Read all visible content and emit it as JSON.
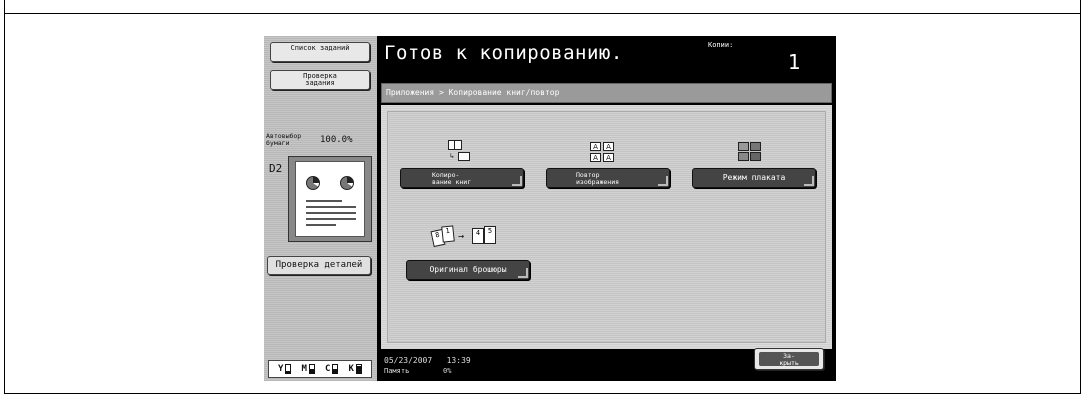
{
  "left_panel": {
    "job_list_button": "Список заданий",
    "check_job_button": "Проверка задания",
    "paper_label": "Автовыбор бумаги",
    "zoom": "100.0%",
    "duplex_icon": "D2",
    "details_button": "Проверка деталей",
    "toner": [
      {
        "label": "Y",
        "level": 0.3
      },
      {
        "label": "M",
        "level": 0.55
      },
      {
        "label": "C",
        "level": 0.45
      },
      {
        "label": "K",
        "level": 0.9
      }
    ]
  },
  "header": {
    "title": "Готов к копированию.",
    "copies_label": "Копии:",
    "copies_value": "1"
  },
  "breadcrumb": "Приложения > Копирование книг/повтор",
  "functions": {
    "book_copy": "Копиро-\nвание книг",
    "image_repeat": "Повтор\nизображения",
    "poster_mode": "Режим плаката",
    "booklet_original": "Оригинал брошюры",
    "aa_labels": [
      "A",
      "A",
      "A",
      "A"
    ]
  },
  "footer": {
    "datetime": "05/23/2007   13:39",
    "memory": "Память        0%",
    "close_button": "За-\nкрыть"
  },
  "colors": {
    "device_bg": "#000000",
    "panel_gray": "#c8c8c8",
    "button_dark": "#444444"
  }
}
